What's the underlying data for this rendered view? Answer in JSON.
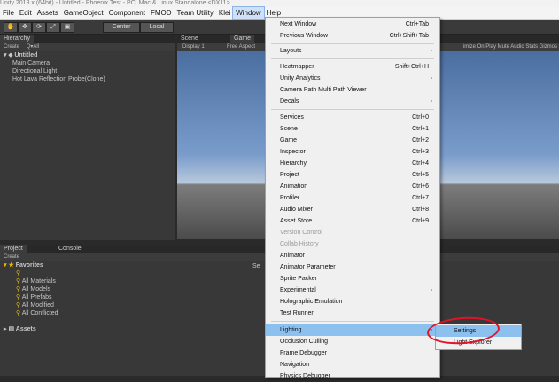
{
  "titlebar": {
    "text": "Unity 2018.x (64bit) - Untitled - Phoenix Test - PC, Mac & Linux Standalone <DX11>"
  },
  "menubar": [
    "File",
    "Edit",
    "Assets",
    "GameObject",
    "Component",
    "FMOD",
    "Team Utility",
    "Klei",
    "Window",
    "Help"
  ],
  "toolbar": {
    "center": "Center",
    "local": "Local"
  },
  "hierarchy": {
    "tab": "Hierarchy",
    "create": "Create",
    "search": "Q▾All",
    "scene": "Untitled",
    "items": [
      "Main Camera",
      "Directional Light",
      "Hot Lava Reflection Probe(Clone)"
    ]
  },
  "scene": {
    "tab_scene": "Scene",
    "tab_game": "Game",
    "display": "Display 1",
    "aspect": "Free Aspect",
    "right_bar": "imize On Play  Mute Audio  Stats  Gizmos"
  },
  "project": {
    "tab_project": "Project",
    "tab_console": "Console",
    "create": "Create",
    "favorites": "Favorites",
    "fav_items": [
      "",
      "All Materials",
      "All Models",
      "All Prefabs",
      "All Modified",
      "All Conflicted"
    ],
    "assets": "Assets",
    "right_header": "Se"
  },
  "window_menu": {
    "items": [
      {
        "label": "Next Window",
        "shortcut": "Ctrl+Tab"
      },
      {
        "label": "Previous Window",
        "shortcut": "Ctrl+Shift+Tab"
      },
      {
        "label": "Layouts",
        "arrow": "›"
      },
      {
        "label": "Heatmapper",
        "shortcut": "Shift+Ctrl+H"
      },
      {
        "label": "Unity Analytics",
        "arrow": "›"
      },
      {
        "label": "Camera Path Multi Path Viewer"
      },
      {
        "label": "Decals",
        "arrow": "›"
      },
      {
        "label": "Services",
        "shortcut": "Ctrl+0"
      },
      {
        "label": "Scene",
        "shortcut": "Ctrl+1"
      },
      {
        "label": "Game",
        "shortcut": "Ctrl+2"
      },
      {
        "label": "Inspector",
        "shortcut": "Ctrl+3"
      },
      {
        "label": "Hierarchy",
        "shortcut": "Ctrl+4"
      },
      {
        "label": "Project",
        "shortcut": "Ctrl+5"
      },
      {
        "label": "Animation",
        "shortcut": "Ctrl+6"
      },
      {
        "label": "Profiler",
        "shortcut": "Ctrl+7"
      },
      {
        "label": "Audio Mixer",
        "shortcut": "Ctrl+8"
      },
      {
        "label": "Asset Store",
        "shortcut": "Ctrl+9"
      },
      {
        "label": "Version Control",
        "disabled": true
      },
      {
        "label": "Collab History",
        "disabled": true
      },
      {
        "label": "Animator"
      },
      {
        "label": "Animator Parameter"
      },
      {
        "label": "Sprite Packer"
      },
      {
        "label": "Experimental",
        "arrow": "›"
      },
      {
        "label": "Holographic Emulation"
      },
      {
        "label": "Test Runner"
      },
      {
        "label": "Lighting",
        "arrow": "›",
        "highlighted": true
      },
      {
        "label": "Occlusion Culling"
      },
      {
        "label": "Frame Debugger"
      },
      {
        "label": "Navigation"
      },
      {
        "label": "Physics Debugger"
      }
    ]
  },
  "lighting_submenu": [
    "Settings",
    "Light Explorer"
  ],
  "colors": {
    "menu_highlight": "#8cc0ee",
    "annotation": "#e0132a"
  }
}
